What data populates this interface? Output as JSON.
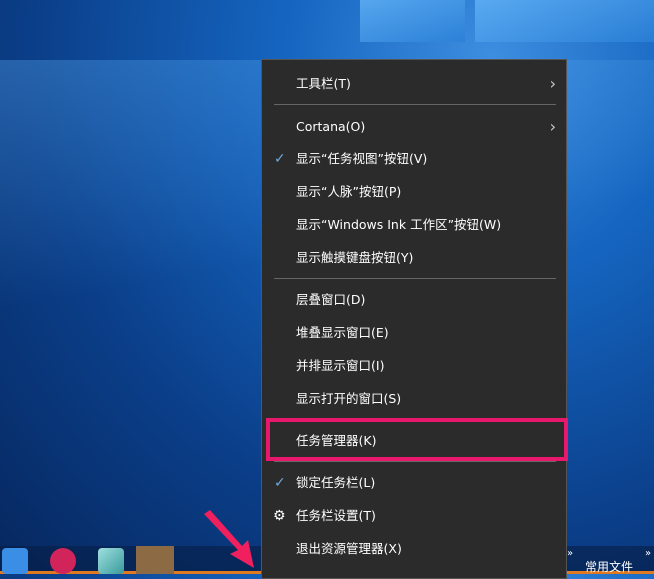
{
  "menu": {
    "items": [
      {
        "label": "工具栏(T)",
        "submenu": true
      },
      {
        "label": "Cortana(O)",
        "submenu": true
      },
      {
        "label": "显示“任务视图”按钮(V)",
        "checked": true
      },
      {
        "label": "显示“人脉”按钮(P)"
      },
      {
        "label": "显示“Windows Ink 工作区”按钮(W)"
      },
      {
        "label": "显示触摸键盘按钮(Y)"
      },
      {
        "label": "层叠窗口(D)"
      },
      {
        "label": "堆叠显示窗口(E)"
      },
      {
        "label": "并排显示窗口(I)"
      },
      {
        "label": "显示打开的窗口(S)"
      },
      {
        "label": "任务管理器(K)",
        "highlighted": true
      },
      {
        "label": "锁定任务栏(L)",
        "checked": true
      },
      {
        "label": "任务栏设置(T)",
        "icon": "gear-icon"
      },
      {
        "label": "退出资源管理器(X)"
      }
    ]
  },
  "taskbar": {
    "more": "»",
    "favorites": "常用文件"
  },
  "colors": {
    "highlight": "#e8196d",
    "menu_bg": "#2b2b2b",
    "check": "#6fa8dc"
  }
}
